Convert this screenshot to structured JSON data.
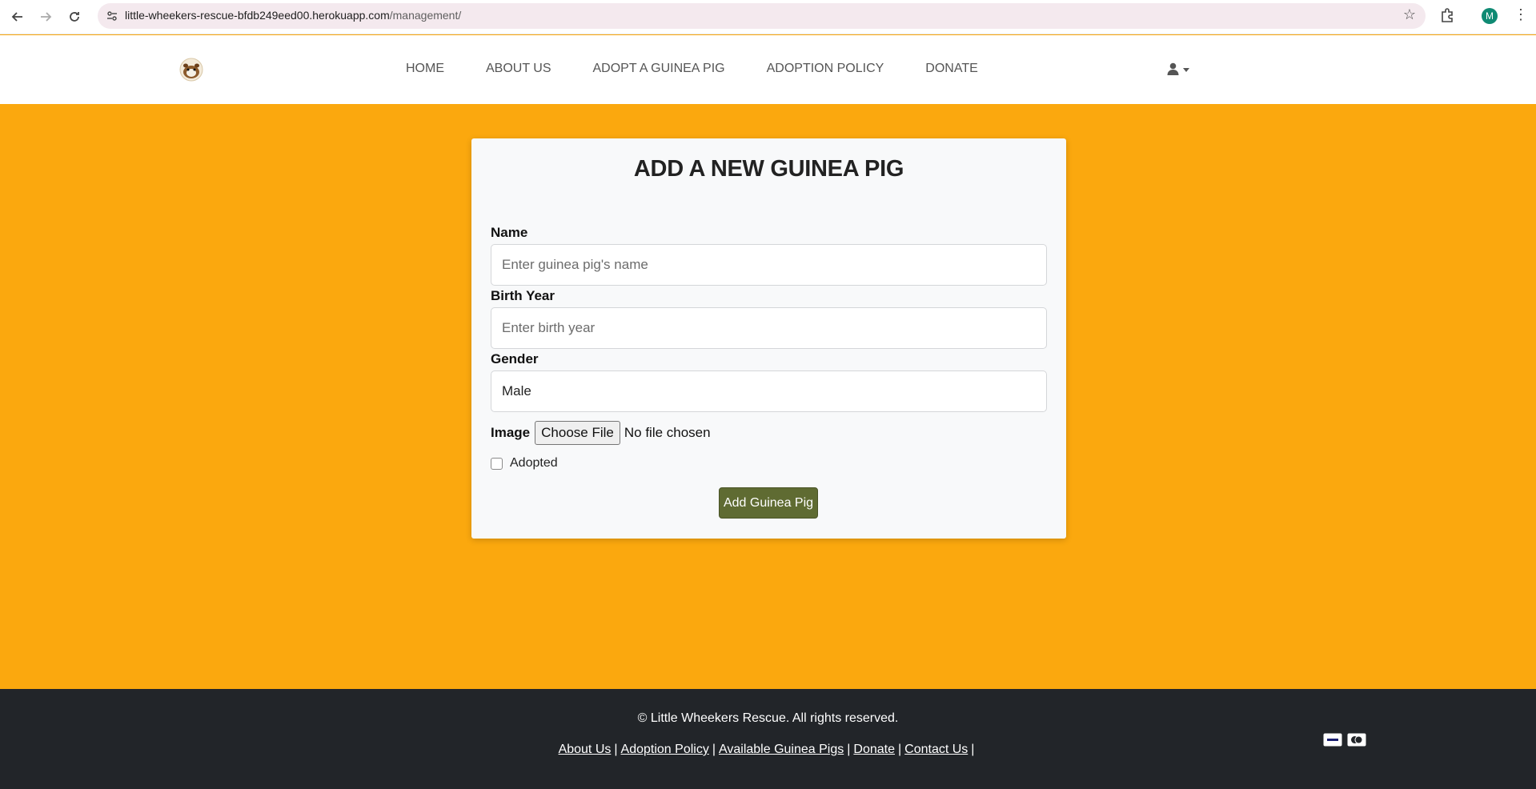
{
  "browser": {
    "url_host": "little-wheekers-rescue-bfdb249eed00.herokuapp.com",
    "url_path": "/management/",
    "profile_initial": "M"
  },
  "header": {
    "nav": [
      "HOME",
      "ABOUT US",
      "ADOPT A GUINEA PIG",
      "ADOPTION POLICY",
      "DONATE"
    ]
  },
  "form": {
    "title": "ADD A NEW GUINEA PIG",
    "name_label": "Name",
    "name_placeholder": "Enter guinea pig's name",
    "birth_label": "Birth Year",
    "birth_placeholder": "Enter birth year",
    "gender_label": "Gender",
    "gender_value": "Male",
    "image_label": "Image",
    "choose_file_label": "Choose File",
    "file_status": "No file chosen",
    "adopted_label": "Adopted",
    "submit_label": "Add Guinea Pig"
  },
  "footer": {
    "copyright": "© Little Wheekers Rescue. All rights reserved.",
    "links": [
      "About Us",
      "Adoption Policy",
      "Available Guinea Pigs",
      "Donate",
      "Contact Us"
    ],
    "trailing_separator": "|"
  },
  "colors": {
    "page_background": "#fba80e",
    "button": "#5f6b32",
    "footer": "#222529"
  }
}
